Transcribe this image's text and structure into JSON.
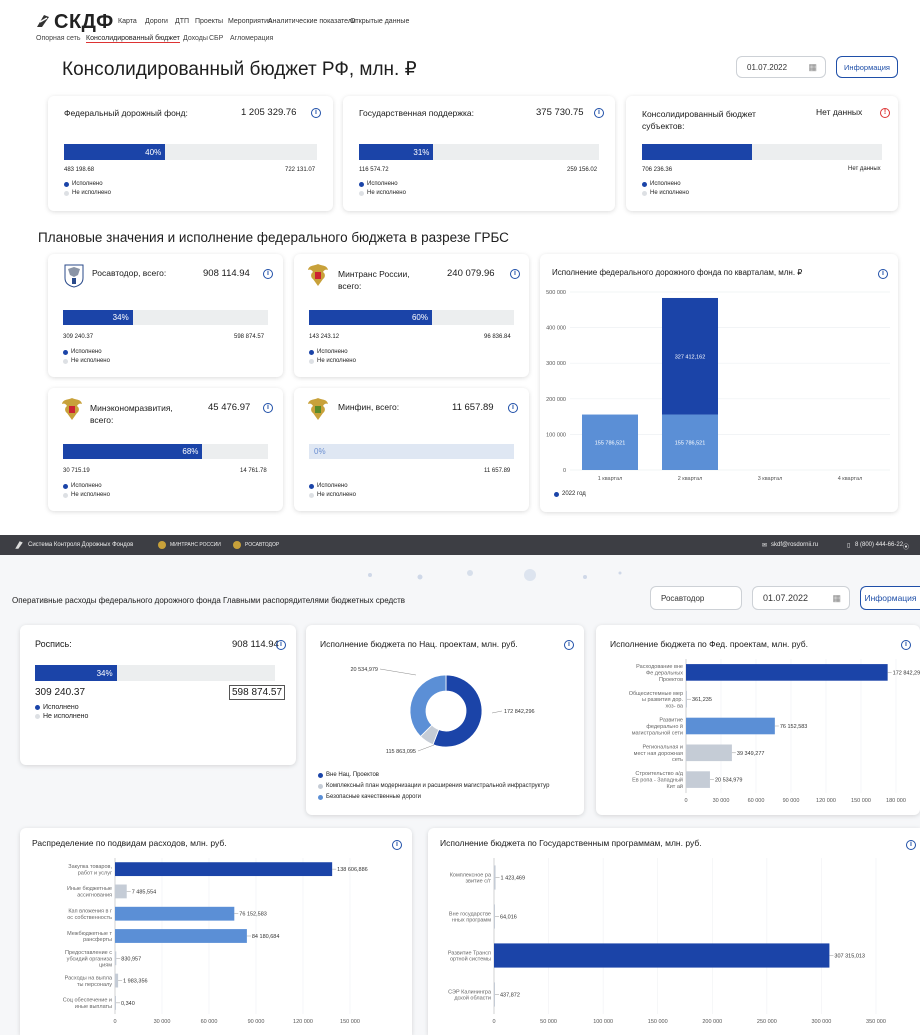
{
  "app": {
    "logo": "СКДФ"
  },
  "nav": [
    "Карта",
    "Дороги",
    "ДТП",
    "Проекты",
    "Мероприятия",
    "Аналитические показатели",
    "Открытые данные"
  ],
  "subnav": [
    "Опорная сеть",
    "Консолидированный бюджет",
    "Доходы",
    "СБР",
    "Агломерация"
  ],
  "page_title": "Консолидированный бюджет РФ, млн. ₽",
  "date": "01.07.2022",
  "info_button": "Информация",
  "legend": {
    "done": "Исполнено",
    "notdone": "Не исполнено"
  },
  "summary": [
    {
      "title": "Федеральный дорожный фонд:",
      "value": "1 205 329.76",
      "pct": "40%",
      "pct_value": 0.4,
      "left": "483 198.68",
      "right": "722 131.07"
    },
    {
      "title": "Государственная поддержка:",
      "value": "375 730.75",
      "pct": "31%",
      "pct_value": 0.31,
      "left": "116 574.72",
      "right": "259 156.02"
    },
    {
      "title": "Консолидированный бюджет субъектов:",
      "value": "Нет данных",
      "pct_value": 0.46,
      "left": "706 236.36",
      "right": "Нет данных"
    }
  ],
  "section2_title": "Плановые значения и исполнение федерального бюджета в разрезе ГРБС",
  "grbs": [
    {
      "title": "Росавтодор, всего:",
      "value": "908 114.94",
      "pct": "34%",
      "pct_value": 0.34,
      "left": "309 240.37",
      "right": "598 874.57"
    },
    {
      "title": "Минтранс России, всего:",
      "value": "240 079.96",
      "pct": "60%",
      "pct_value": 0.6,
      "left": "143 243.12",
      "right": "96 836.84"
    },
    {
      "title": "Минэкономразвития, всего:",
      "value": "45 476.97",
      "pct": "68%",
      "pct_value": 0.68,
      "left": "30 715.19",
      "right": "14 761.78"
    },
    {
      "title": "Минфин, всего:",
      "value": "11 657.89",
      "pct": "0%",
      "pct_value": 0.0,
      "left": "",
      "right": "11 657.89"
    }
  ],
  "quarter_chart": {
    "title": "Исполнение федерального дорожного фонда по кварталам, млн. ₽",
    "legend": "2022 год"
  },
  "darkbar": {
    "system": "Система Контроля Дорожных Фондов",
    "mintrans": "МИНТРАНС РОССИИ",
    "rosavtodor": "РОСАВТОДОР",
    "email": "skdf@rosdornii.ru",
    "phone": "8 (800) 444-66-22"
  },
  "ops": {
    "title": "Оперативные расходы федерального дорожного фонда Главными распорядителями бюджетных средств",
    "select": "Росавтодор",
    "date": "01.07.2022",
    "button": "Информация"
  },
  "rospis": {
    "title": "Роспись:",
    "value": "908 114.94",
    "pct": "34%",
    "pct_value": 0.34,
    "left": "309 240.37",
    "right": "598 874.57"
  },
  "nat": {
    "title": "Исполнение бюджета по Нац. проектам, млн. руб.",
    "legend": [
      "Вне Нац. Проектов",
      "Комплексный план модернизации и расширения магистральной инфраструктур",
      "Безопасные качественные дороги"
    ]
  },
  "fed": {
    "title": "Исполнение бюджета по Фед. проектам, млн. руб."
  },
  "vid": {
    "title": "Распределение по подвидам расходов, млн. руб."
  },
  "gp": {
    "title": "Исполнение бюджета по Государственным программам, млн. руб."
  },
  "colors": {
    "dark": "#1b44a8",
    "mid": "#5b8fd6",
    "light": "#c5ccd6"
  },
  "chart_data": [
    {
      "type": "bar",
      "title": "Исполнение федерального дорожного фонда по кварталам, млн. ₽",
      "categories": [
        "1 квартал",
        "2 квартал",
        "3 квартал",
        "4 квартал"
      ],
      "series": [
        {
          "name": "2022 год",
          "values": [
            155786.521,
            155786.521,
            0,
            0
          ]
        },
        {
          "name": "",
          "values": [
            0,
            327412.162,
            0,
            0
          ]
        }
      ],
      "y_ticks": [
        "0",
        "100 000",
        "200 000",
        "300 000",
        "400 000",
        "500 000"
      ],
      "ylim": [
        0,
        500000
      ],
      "labels": [
        "155 786,521",
        "155 786,521",
        "327 412,162"
      ]
    },
    {
      "type": "pie",
      "title": "Исполнение бюджета по Нац. проектам, млн. руб.",
      "labels": [
        "Вне Нац. Проектов",
        "Комплексный план модернизации и расширения магистральной инфраструктур",
        "Безопасные качественные дороги"
      ],
      "values": [
        172842.296,
        20534.979,
        115863.095
      ],
      "value_labels": [
        "172 842,296",
        "20 534,979",
        "115 863,095"
      ]
    },
    {
      "type": "bar",
      "title": "Исполнение бюджета по Фед. проектам, млн. руб.",
      "categories": [
        "Расходование вне Фе деральных Проектов",
        "Общесистемные мер ы развития дор. хоз- ва",
        "Развитие федерально й магистральной сети",
        "Региональная и мест ная дорожная сеть",
        "Строительство а/д Ев ропа - Западный Кит ай"
      ],
      "values": [
        172842.296,
        361.235,
        76152.583,
        39349.277,
        20534.979
      ],
      "value_labels": [
        "172 842,296",
        "361,235",
        "76 152,583",
        "39 349,277",
        "20 534,979"
      ],
      "x_ticks": [
        "0",
        "30 000",
        "60 000",
        "90 000",
        "120 000",
        "150 000",
        "180 000"
      ],
      "xlim": [
        0,
        180000
      ]
    },
    {
      "type": "bar",
      "title": "Распределение по подвидам расходов, млн. руб.",
      "categories": [
        "Закупка товаров, работ и услуг",
        "Иные бюджетные ассигнования",
        "Кап вложения в г ос собственность",
        "Межбюджетные т рансферты",
        "Предоставление с убсидий организа циям",
        "Расходы на выпла ты персоналу",
        "Соц обеспечение и иные выплаты"
      ],
      "values": [
        138606.886,
        7485.554,
        76152.583,
        84180.684,
        830.957,
        1983.356,
        0.34
      ],
      "value_labels": [
        "138 606,886",
        "7 485,554",
        "76 152,583",
        "84 180,684",
        "830,957",
        "1 983,356",
        "0,340"
      ],
      "x_ticks": [
        "0",
        "30 000",
        "60 000",
        "90 000",
        "120 000",
        "150 000"
      ],
      "xlim": [
        0,
        150000
      ]
    },
    {
      "type": "bar",
      "title": "Исполнение бюджета по Государственным программам, млн. руб.",
      "categories": [
        "Комплексное ра звитие с/т",
        "Вне государстве нных программ",
        "Развитие Трансп ортной системы",
        "СЭР Калинингра дской области"
      ],
      "values": [
        1423.469,
        64.016,
        307315.013,
        437.872
      ],
      "value_labels": [
        "1 423,469",
        "64,016",
        "307 315,013",
        "437,872"
      ],
      "x_ticks": [
        "0",
        "50 000",
        "100 000",
        "150 000",
        "200 000",
        "250 000",
        "300 000",
        "350 000"
      ],
      "xlim": [
        0,
        350000
      ]
    }
  ]
}
